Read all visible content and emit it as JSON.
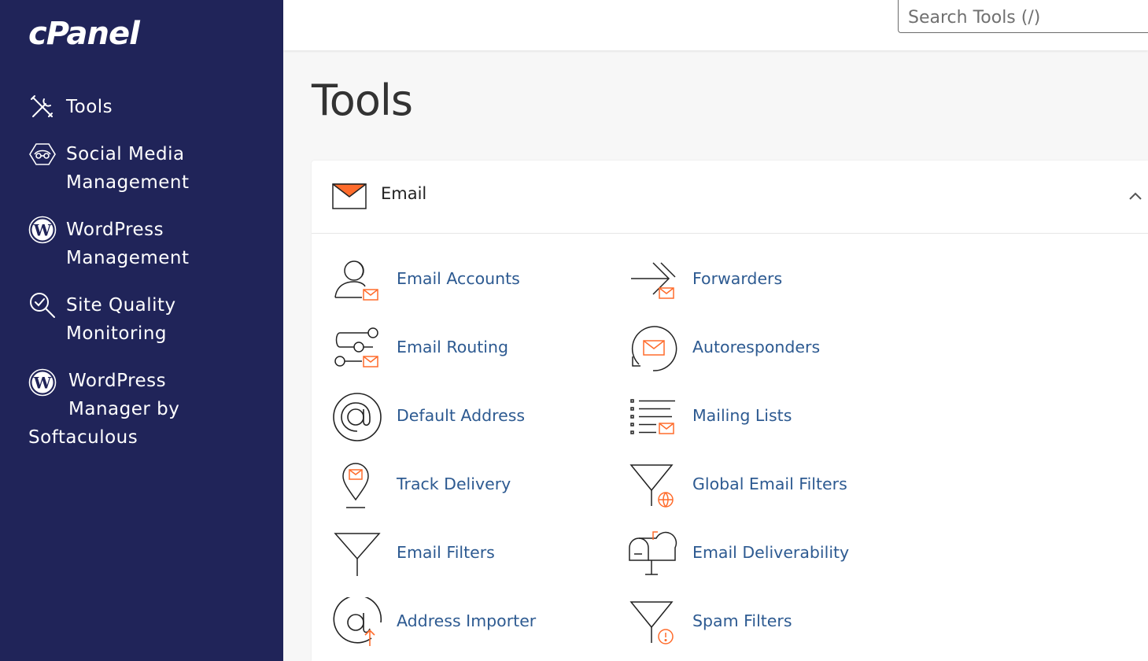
{
  "app": {
    "logo_text": "cPanel"
  },
  "sidebar": {
    "items": [
      {
        "label": "Tools",
        "icon": "tools-icon"
      },
      {
        "label": "Social Media Management",
        "icon": "social-media-icon"
      },
      {
        "label": "WordPress Management",
        "icon": "wordpress-icon"
      },
      {
        "label": "Site Quality Monitoring",
        "icon": "site-quality-icon"
      },
      {
        "label_line1": "WordPress",
        "label_line2": "Manager by",
        "label_line3": "Softaculous",
        "icon": "wordpress-icon"
      }
    ]
  },
  "header": {
    "search_placeholder": "Search Tools (/)"
  },
  "main": {
    "title": "Tools",
    "section": {
      "title": "Email",
      "icon": "envelope-icon",
      "collapse_icon": "chevron-up-icon",
      "tools": [
        {
          "label": "Email Accounts",
          "icon": "email-accounts-icon"
        },
        {
          "label": "Forwarders",
          "icon": "forwarders-icon"
        },
        {
          "label": "Email Routing",
          "icon": "email-routing-icon"
        },
        {
          "label": "Autoresponders",
          "icon": "autoresponders-icon"
        },
        {
          "label": "Default Address",
          "icon": "default-address-icon"
        },
        {
          "label": "Mailing Lists",
          "icon": "mailing-lists-icon"
        },
        {
          "label": "Track Delivery",
          "icon": "track-delivery-icon"
        },
        {
          "label": "Global Email Filters",
          "icon": "global-email-filters-icon"
        },
        {
          "label": "Email Filters",
          "icon": "email-filters-icon"
        },
        {
          "label": "Email Deliverability",
          "icon": "email-deliverability-icon"
        },
        {
          "label": "Address Importer",
          "icon": "address-importer-icon"
        },
        {
          "label": "Spam Filters",
          "icon": "spam-filters-icon"
        }
      ]
    }
  },
  "colors": {
    "sidebar_bg": "#202459",
    "link": "#2d5a91",
    "accent_orange": "#ff6c2c",
    "page_bg": "#f7f7f7"
  }
}
